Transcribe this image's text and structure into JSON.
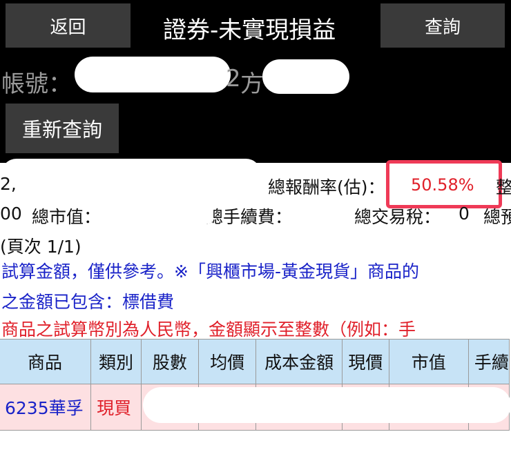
{
  "header": {
    "back_label": "返回",
    "title": "證券-未實現損益",
    "query_label": "查詢"
  },
  "account": {
    "label": "帳號：",
    "fragment1": "2",
    "fragment2": "方"
  },
  "requery_label": "重新查詢",
  "summary": {
    "left_fragment": "2,",
    "return_label": "總報酬率(估)：",
    "return_value": "50.58%",
    "right_cut1": "整",
    "row2_left": "00",
    "market_value_label": "總市值：",
    "fee_label": "總手續費：",
    "tax_label": "總交易稅：",
    "tax_value": "0",
    "right_cut2": "總預"
  },
  "page_info": "(頁次 1/1)",
  "notes": {
    "line1": "試算金額，僅供參考。※「興櫃市場-黃金現貨」商品的",
    "line2": "之金額已包含：標借費",
    "line3": "商品之試算幣別為人民幣，金額顯示至整數（例如：手"
  },
  "table": {
    "columns": [
      "商品",
      "類別",
      "股數",
      "均價",
      "成本金額",
      "現價",
      "市值",
      "手續"
    ],
    "rows": [
      {
        "product": "6235華孚",
        "type": "現買"
      }
    ]
  }
}
